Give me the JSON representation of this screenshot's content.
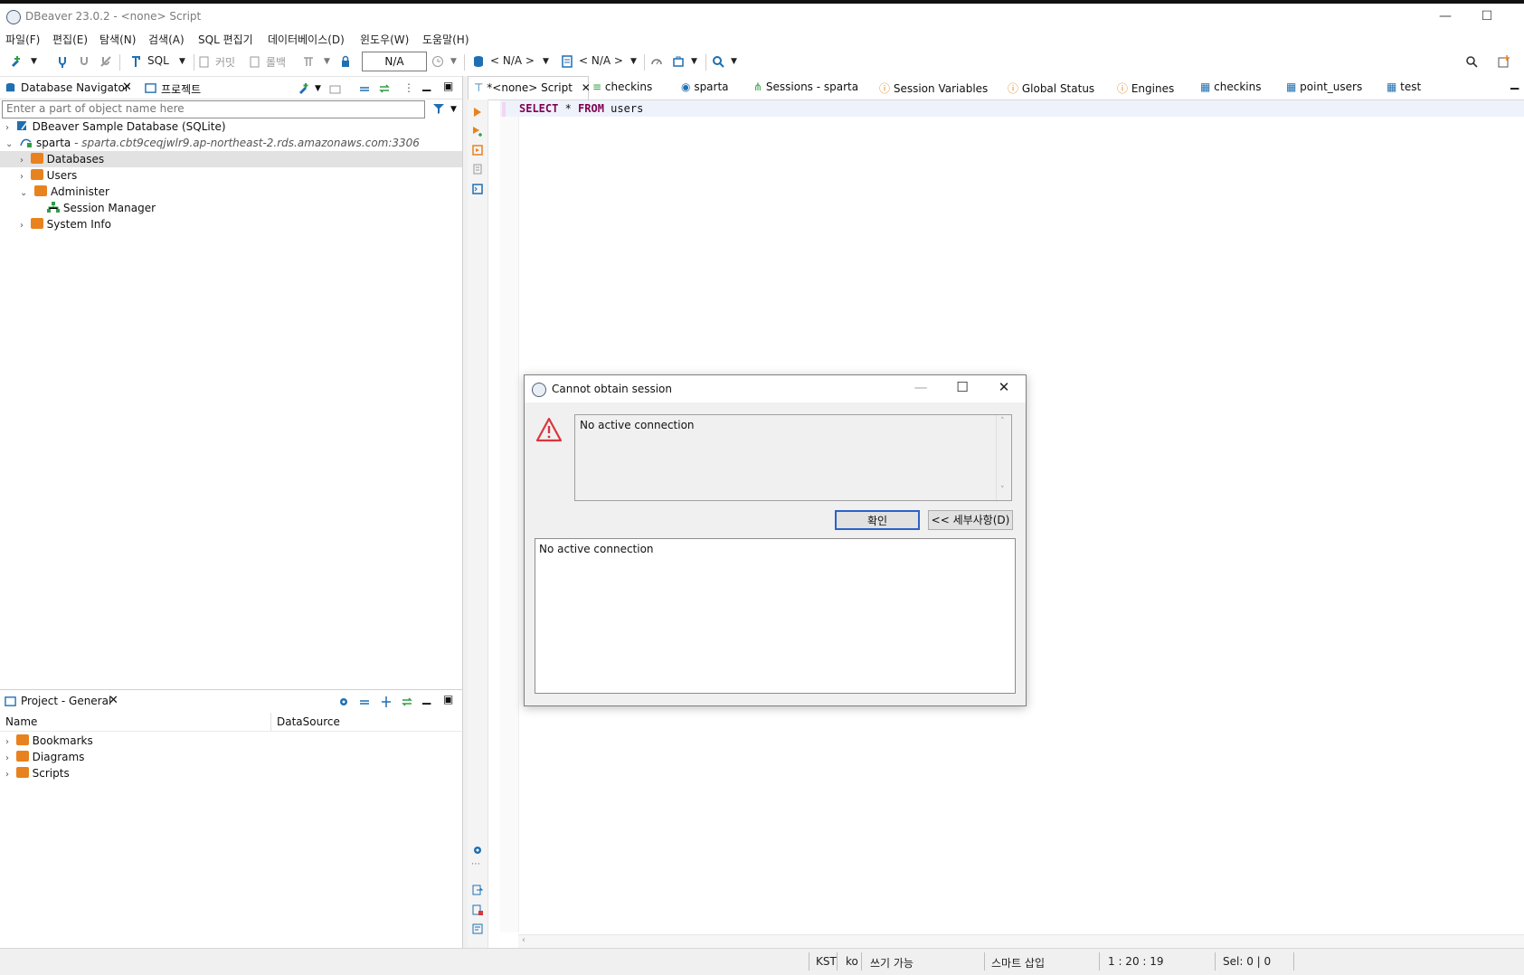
{
  "window": {
    "title": "DBeaver 23.0.2 - <none> Script",
    "minimize_glyph": "—",
    "maximize_glyph": "☐"
  },
  "menu": [
    "파일(F)",
    "편집(E)",
    "탐색(N)",
    "검색(A)",
    "SQL 편집기",
    "데이터베이스(D)",
    "윈도우(W)",
    "도움말(H)"
  ],
  "toolbar": {
    "sql_label": "SQL",
    "commit_label": "커밋",
    "rollback_label": "롤백",
    "transaction_combo_value": "N/A",
    "datasource_selector": "< N/A >",
    "schema_selector": "< N/A >"
  },
  "navigator": {
    "tab_label": "Database Navigator",
    "projects_tab_label": "프로젝트",
    "filter_placeholder": "Enter a part of object name here",
    "tree": [
      {
        "label": "DBeaver Sample Database (SQLite)",
        "detail": "",
        "depth": 0,
        "expanded": false
      },
      {
        "label": "sparta",
        "detail": " - sparta.cbt9ceqjwlr9.ap-northeast-2.rds.amazonaws.com:3306",
        "depth": 0,
        "expanded": true
      },
      {
        "label": "Databases",
        "detail": "",
        "depth": 1,
        "expanded": false,
        "selected": true
      },
      {
        "label": "Users",
        "detail": "",
        "depth": 1,
        "expanded": false
      },
      {
        "label": "Administer",
        "detail": "",
        "depth": 1,
        "expanded": true
      },
      {
        "label": "Session Manager",
        "detail": "",
        "depth": 2,
        "expanded": false
      },
      {
        "label": "System Info",
        "detail": "",
        "depth": 1,
        "expanded": false
      }
    ]
  },
  "project": {
    "tab_label": "Project - General",
    "col_name": "Name",
    "col_datasource": "DataSource",
    "items": [
      "Bookmarks",
      "Diagrams",
      "Scripts"
    ]
  },
  "editor": {
    "tabs": [
      "*<none> Script",
      "checkins",
      "sparta",
      "Sessions - sparta",
      "Session Variables",
      "Global Status",
      "Engines",
      "checkins",
      "point_users",
      "test"
    ],
    "code_kw1": "SELECT",
    "code_star": " * ",
    "code_kw2": "FROM",
    "code_rest": " users"
  },
  "dialog": {
    "title": "Cannot obtain session",
    "message": "No active connection",
    "ok_label": "확인",
    "details_label": "<< 세부사항(D)",
    "details_text": "No active connection"
  },
  "statusbar": {
    "timezone": "KST",
    "locale": "ko",
    "mode": "쓰기 가능",
    "insert_mode": "스마트 삽입",
    "position": "1 : 20 : 19",
    "selection": "Sel: 0 | 0"
  },
  "colors": {
    "keyword": "#7f0055",
    "accent": "#2a62c9",
    "warning": "#d9363e"
  }
}
